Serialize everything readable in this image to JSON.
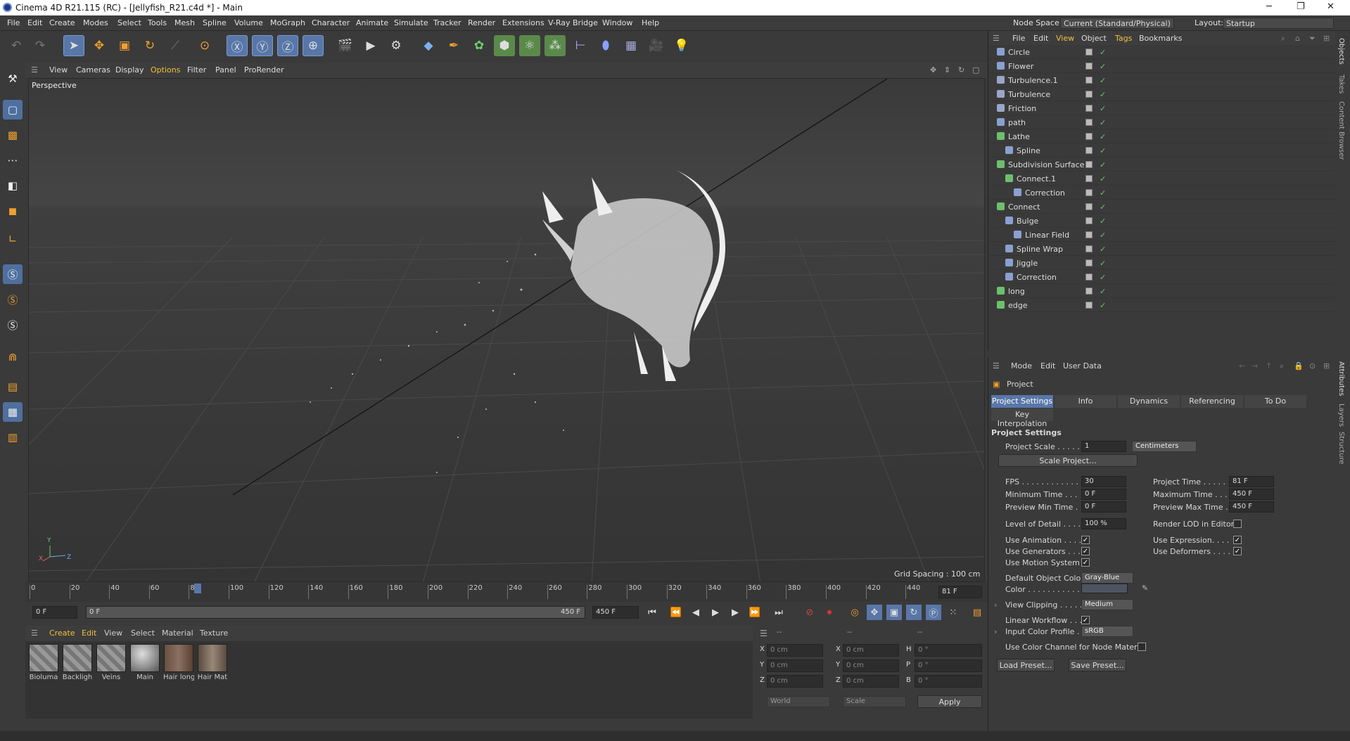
{
  "window": {
    "title": "Cinema 4D R21.115 (RC) - [Jellyfish_R21.c4d *] - Main",
    "min": "─",
    "max": "❐",
    "close": "✕"
  },
  "menu": [
    "File",
    "Edit",
    "Create",
    "Modes",
    "Select",
    "Tools",
    "Mesh",
    "Spline",
    "Volume",
    "MoGraph",
    "Character",
    "Animate",
    "Simulate",
    "Tracker",
    "Render",
    "Extensions",
    "V-Ray Bridge",
    "Window",
    "Help"
  ],
  "nodespace": {
    "label": "Node Space:",
    "value": "Current (Standard/Physical)"
  },
  "layout": {
    "label": "Layout:",
    "value": "Startup"
  },
  "viewport": {
    "menu": [
      "View",
      "Cameras",
      "Display",
      "Options",
      "Filter",
      "Panel",
      "ProRender"
    ],
    "name": "Perspective",
    "grid": "Grid Spacing : 100 cm",
    "axis_y": "Y",
    "axis_x": "X",
    "axis_z": "Z"
  },
  "timeline": {
    "ticks": [
      "0",
      "20",
      "40",
      "60",
      "81",
      "100",
      "120",
      "140",
      "160",
      "180",
      "200",
      "220",
      "240",
      "260",
      "280",
      "300",
      "320",
      "340",
      "360",
      "380",
      "400",
      "420",
      "440"
    ],
    "current": "81 F"
  },
  "transport": {
    "start": "0 F",
    "range_start": "0 F",
    "range_end": "450 F",
    "end": "450 F"
  },
  "materials": {
    "menu": [
      "Create",
      "Edit",
      "View",
      "Select",
      "Material",
      "Texture"
    ],
    "items": [
      "Bioluma",
      "Backligh",
      "Veins",
      "Main",
      "Hair long",
      "Hair Mat"
    ]
  },
  "coords": {
    "head": [
      "--",
      "--",
      "--"
    ],
    "rows": [
      {
        "a": "X",
        "av": "0 cm",
        "b": "X",
        "bv": "0 cm",
        "c": "H",
        "cv": "0 °"
      },
      {
        "a": "Y",
        "av": "0 cm",
        "b": "Y",
        "bv": "0 cm",
        "c": "P",
        "cv": "0 °"
      },
      {
        "a": "Z",
        "av": "0 cm",
        "b": "Z",
        "bv": "0 cm",
        "c": "B",
        "cv": "0 °"
      }
    ],
    "world": "World",
    "scale": "Scale",
    "apply": "Apply"
  },
  "objects": {
    "menu": [
      "File",
      "Edit",
      "View",
      "Object",
      "Tags",
      "Bookmarks"
    ],
    "items": [
      {
        "name": "Circle",
        "indent": 0,
        "color": "#8aa0d0"
      },
      {
        "name": "Flower",
        "indent": 0,
        "color": "#8aa0d0"
      },
      {
        "name": "Turbulence.1",
        "indent": 0,
        "color": "#9aa6c8"
      },
      {
        "name": "Turbulence",
        "indent": 0,
        "color": "#9aa6c8"
      },
      {
        "name": "Friction",
        "indent": 0,
        "color": "#9aa6c8"
      },
      {
        "name": "path",
        "indent": 0,
        "color": "#8aa0d0"
      },
      {
        "name": "Lathe",
        "indent": 0,
        "color": "#6cc06c"
      },
      {
        "name": "Spline",
        "indent": 1,
        "color": "#8aa0d0"
      },
      {
        "name": "Subdivision Surface",
        "indent": 0,
        "color": "#6cc06c"
      },
      {
        "name": "Connect.1",
        "indent": 1,
        "color": "#6cc06c"
      },
      {
        "name": "Correction",
        "indent": 2,
        "color": "#8aa0d0"
      },
      {
        "name": "Connect",
        "indent": 0,
        "color": "#6cc06c"
      },
      {
        "name": "Bulge",
        "indent": 1,
        "color": "#8aa0d0"
      },
      {
        "name": "Linear Field",
        "indent": 2,
        "color": "#8aa0d0"
      },
      {
        "name": "Spline Wrap",
        "indent": 1,
        "color": "#8aa0d0"
      },
      {
        "name": "Jiggle",
        "indent": 1,
        "color": "#8aa0d0"
      },
      {
        "name": "Correction",
        "indent": 1,
        "color": "#8aa0d0"
      },
      {
        "name": "long",
        "indent": 0,
        "color": "#6cc06c"
      },
      {
        "name": "edge",
        "indent": 0,
        "color": "#6cc06c"
      }
    ]
  },
  "attributes": {
    "menu": [
      "Mode",
      "Edit",
      "User Data"
    ],
    "object": "Project",
    "tabs": [
      "Project Settings",
      "Info",
      "Dynamics",
      "Referencing",
      "To Do"
    ],
    "subtab": "Key Interpolation",
    "section": "Project Settings",
    "project_scale": {
      "label": "Project Scale . . . . .",
      "value": "1",
      "unit": "Centimeters"
    },
    "scale_btn": "Scale Project...",
    "fps": {
      "label": "FPS . . . . . . . . . . . .",
      "value": "30"
    },
    "project_time": {
      "label": "Project Time . . . . .",
      "value": "81 F"
    },
    "min_time": {
      "label": "Minimum Time . . .",
      "value": "0 F"
    },
    "max_time": {
      "label": "Maximum Time . . .",
      "value": "450 F"
    },
    "prev_min": {
      "label": "Preview Min Time . .",
      "value": "0 F"
    },
    "prev_max": {
      "label": "Preview Max Time . .",
      "value": "450 F"
    },
    "lod": {
      "label": "Level of Detail . . . .",
      "value": "100 %"
    },
    "render_lod": "Render LOD in Editor",
    "use_anim": "Use Animation . . . .",
    "use_expr": "Use Expression. . . .",
    "use_gen": "Use Generators . . .",
    "use_def": "Use Deformers . . . .",
    "use_motion": "Use Motion System",
    "default_color": {
      "label": "Default Object Color",
      "value": "Gray-Blue"
    },
    "color": "Color . . . . . . . . . . .",
    "view_clip": {
      "label": "View Clipping . . . . .",
      "value": "Medium"
    },
    "linear": "Linear Workflow . . .",
    "input_profile": {
      "label": "Input Color Profile . .",
      "value": "sRGB"
    },
    "node_channel": "Use Color Channel for Node Material",
    "load": "Load Preset...",
    "save": "Save Preset..."
  },
  "sidetabs": [
    "Objects",
    "Takes",
    "Content Browser",
    "Attributes",
    "Layers",
    "Structure"
  ]
}
